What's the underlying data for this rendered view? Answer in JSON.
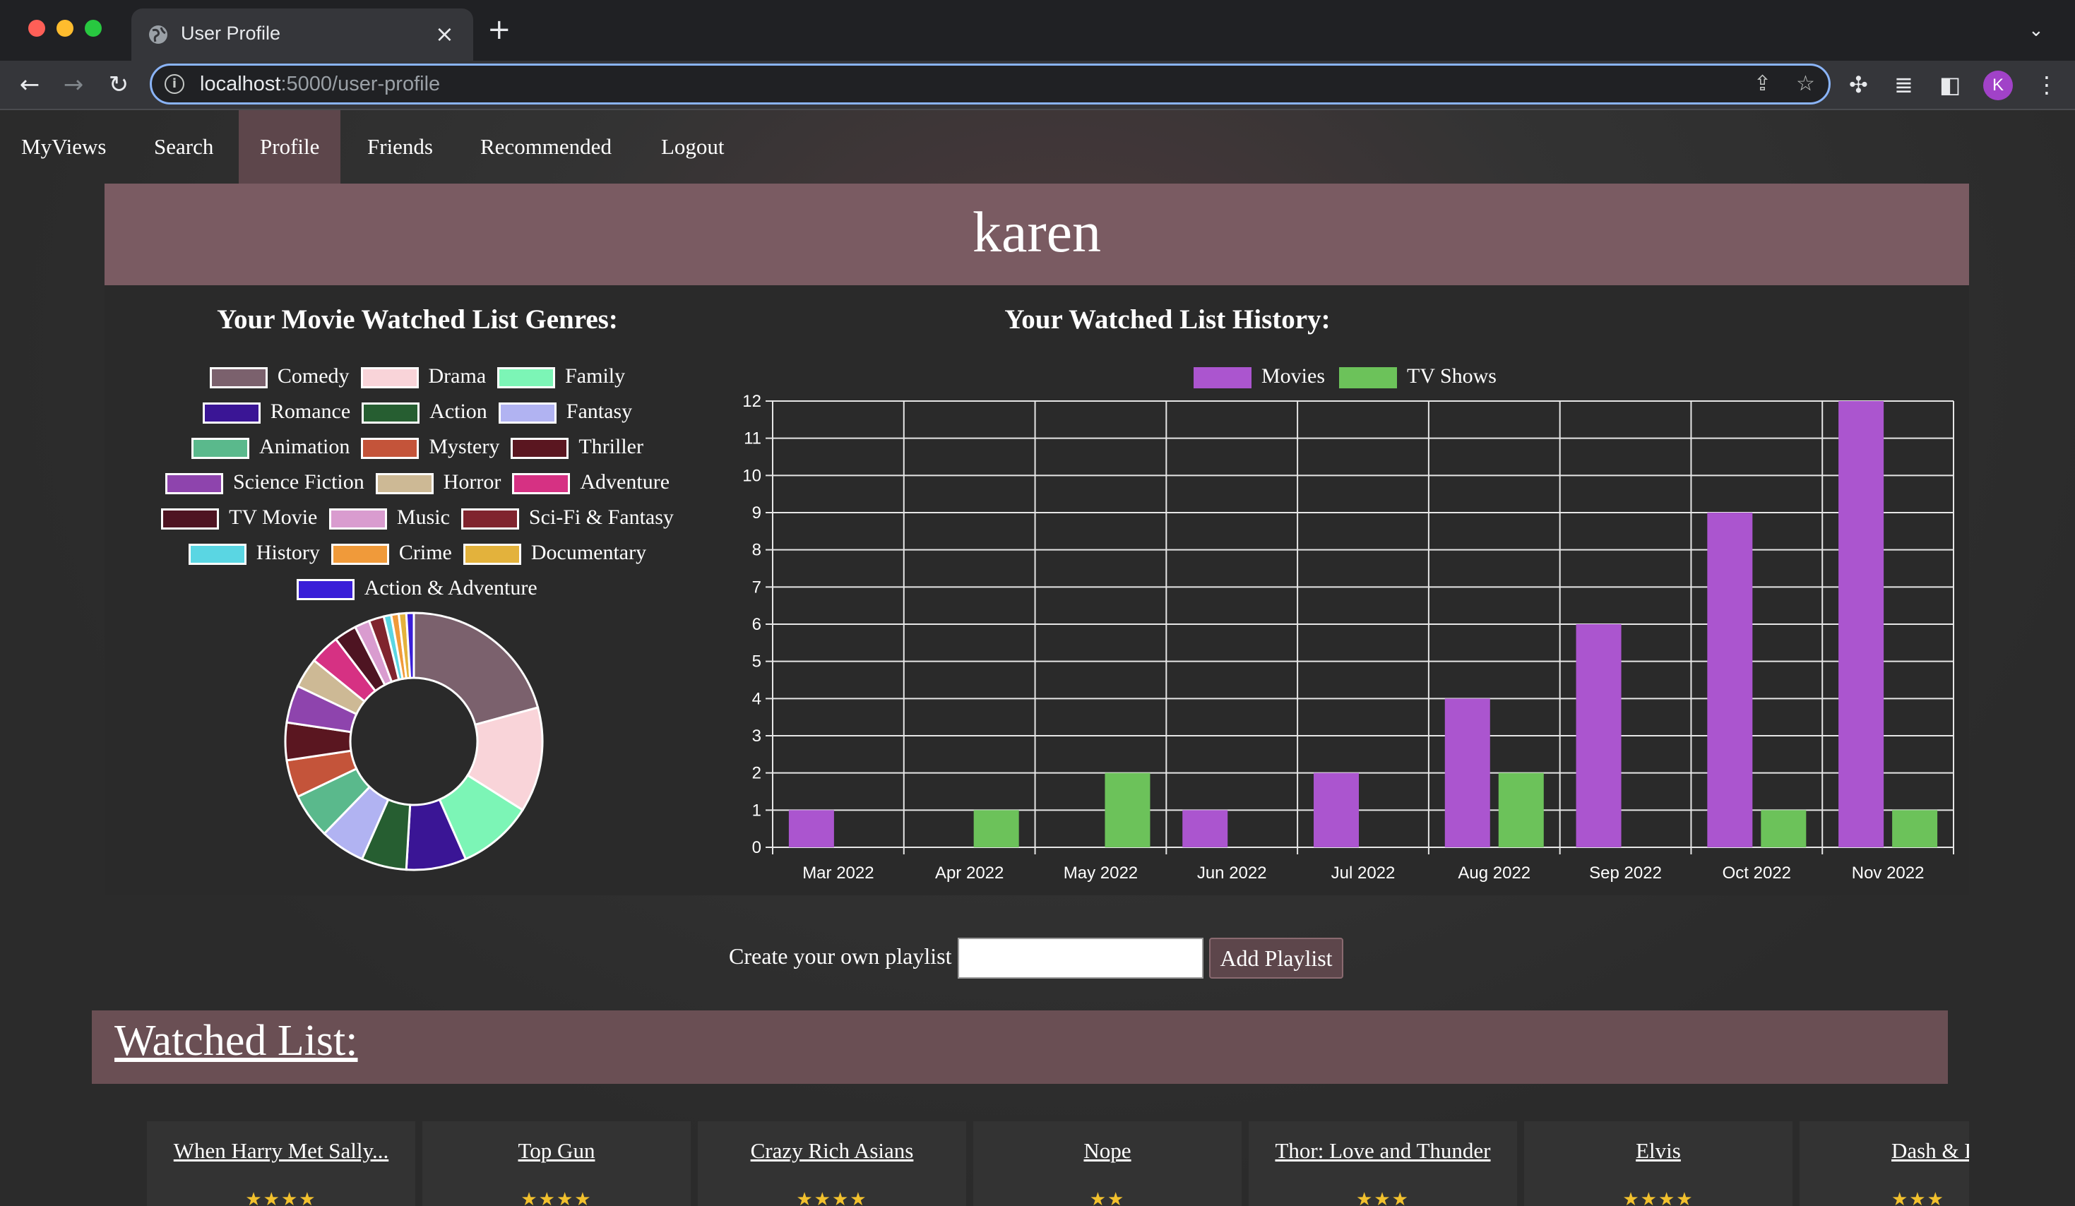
{
  "browser": {
    "tab_title": "User Profile",
    "url_host": "localhost",
    "url_rest": ":5000/user-profile",
    "profile_initial": "K"
  },
  "nav": {
    "items": [
      {
        "label": "MyViews"
      },
      {
        "label": "Search"
      },
      {
        "label": "Profile",
        "active": true
      },
      {
        "label": "Friends"
      },
      {
        "label": "Recommended"
      },
      {
        "label": "Logout"
      }
    ]
  },
  "user": {
    "name": "karen"
  },
  "genres_chart": {
    "title": "Your Movie Watched List Genres:",
    "legend": [
      {
        "label": "Comedy",
        "color": "#7b616d"
      },
      {
        "label": "Drama",
        "color": "#f9d4d9"
      },
      {
        "label": "Family",
        "color": "#7cf5b6"
      },
      {
        "label": "Romance",
        "color": "#3a1595"
      },
      {
        "label": "Action",
        "color": "#265e31"
      },
      {
        "label": "Fantasy",
        "color": "#b1b3f2"
      },
      {
        "label": "Animation",
        "color": "#5ab98c"
      },
      {
        "label": "Mystery",
        "color": "#c4543a"
      },
      {
        "label": "Thriller",
        "color": "#5a1620"
      },
      {
        "label": "Science Fiction",
        "color": "#8e44ad"
      },
      {
        "label": "Horror",
        "color": "#cdb995"
      },
      {
        "label": "Adventure",
        "color": "#d63183"
      },
      {
        "label": "TV Movie",
        "color": "#4e1422"
      },
      {
        "label": "Music",
        "color": "#d99ccf"
      },
      {
        "label": "Sci-Fi & Fantasy",
        "color": "#80242e"
      },
      {
        "label": "History",
        "color": "#5ad6e3"
      },
      {
        "label": "Crime",
        "color": "#f09a3a"
      },
      {
        "label": "Documentary",
        "color": "#e3b23c"
      },
      {
        "label": "Action & Adventure",
        "color": "#3a1fd8"
      }
    ]
  },
  "chart_data": [
    {
      "type": "pie",
      "title": "Your Movie Watched List Genres:",
      "categories": [
        "Comedy",
        "Drama",
        "Family",
        "Romance",
        "Action",
        "Fantasy",
        "Animation",
        "Mystery",
        "Thriller",
        "Science Fiction",
        "Horror",
        "Adventure",
        "TV Movie",
        "Music",
        "Sci-Fi & Fantasy",
        "History",
        "Crime",
        "Documentary",
        "Action & Adventure"
      ],
      "values": [
        22,
        14,
        10,
        8,
        6,
        6,
        6,
        5,
        5,
        5,
        4,
        4,
        3,
        2,
        2,
        1,
        1,
        1,
        1
      ],
      "colors": [
        "#7b616d",
        "#f9d4d9",
        "#7cf5b6",
        "#3a1595",
        "#265e31",
        "#b1b3f2",
        "#5ab98c",
        "#c4543a",
        "#5a1620",
        "#8e44ad",
        "#cdb995",
        "#d63183",
        "#4e1422",
        "#d99ccf",
        "#80242e",
        "#5ad6e3",
        "#f09a3a",
        "#e3b23c",
        "#3a1fd8"
      ],
      "donut": true,
      "legend": "top"
    },
    {
      "type": "bar",
      "title": "Your Watched List History:",
      "categories": [
        "Mar 2022",
        "Apr 2022",
        "May 2022",
        "Jun 2022",
        "Jul 2022",
        "Aug 2022",
        "Sep 2022",
        "Oct 2022",
        "Nov 2022"
      ],
      "series": [
        {
          "name": "Movies",
          "color": "#ab55cf",
          "values": [
            1,
            0,
            0,
            1,
            2,
            4,
            6,
            9,
            12
          ]
        },
        {
          "name": "TV Shows",
          "color": "#6cc25a",
          "values": [
            0,
            1,
            2,
            0,
            0,
            2,
            0,
            1,
            1
          ]
        }
      ],
      "ylim": [
        0,
        12
      ],
      "yticks": [
        0,
        1,
        2,
        3,
        4,
        5,
        6,
        7,
        8,
        9,
        10,
        11,
        12
      ],
      "grid": true,
      "legend": "top"
    }
  ],
  "history_chart": {
    "title": "Your Watched List History:"
  },
  "playlist": {
    "label": "Create your own playlist",
    "input_value": "",
    "button_label": "Add Playlist"
  },
  "watched": {
    "title": "Watched List:",
    "items": [
      {
        "title": "When Harry Met Sally...",
        "stars": "★★★★"
      },
      {
        "title": "Top Gun",
        "stars": "★★★★"
      },
      {
        "title": "Crazy Rich Asians",
        "stars": "★★★★"
      },
      {
        "title": "Nope",
        "stars": "★★"
      },
      {
        "title": "Thor: Love and Thunder",
        "stars": "★★★"
      },
      {
        "title": "Elvis",
        "stars": "★★★★"
      },
      {
        "title": "Dash & L",
        "stars": "★★★"
      }
    ]
  }
}
